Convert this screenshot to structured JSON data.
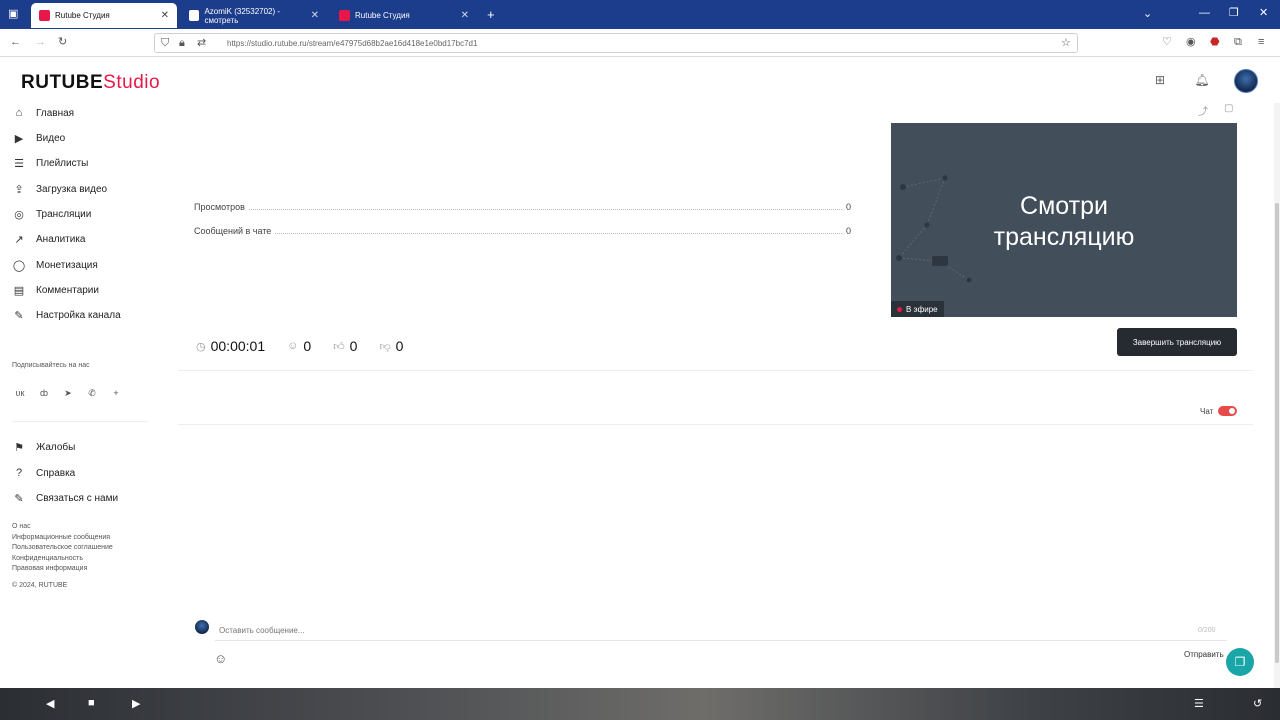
{
  "browser": {
    "tabs": [
      {
        "title": "Rutube Студия",
        "active": true,
        "favicon_color": "#e8174a"
      },
      {
        "title": "AzomiK (32532702) - смотреть",
        "active": false,
        "favicon_color": "#ffffff"
      },
      {
        "title": "Rutube Студия",
        "active": false,
        "favicon_color": "#e8174a"
      }
    ],
    "url": "https://studio.rutube.ru/stream/e47975d68b2ae16d418e1e0bd17bc7d1"
  },
  "app": {
    "logo_main": "RUTUBE",
    "logo_studio": "Studio"
  },
  "sidebar": {
    "items": [
      {
        "label": "Главная",
        "icon": "home-icon"
      },
      {
        "label": "Видео",
        "icon": "video-icon"
      },
      {
        "label": "Плейлисты",
        "icon": "playlist-icon"
      },
      {
        "label": "Загрузка видео",
        "icon": "upload-icon"
      },
      {
        "label": "Трансляции",
        "icon": "broadcast-icon"
      },
      {
        "label": "Аналитика",
        "icon": "analytics-icon"
      },
      {
        "label": "Монетизация",
        "icon": "money-icon"
      },
      {
        "label": "Комментарии",
        "icon": "comments-icon"
      },
      {
        "label": "Настройка канала",
        "icon": "settings-icon"
      }
    ],
    "subscribe_label": "Подписывайтесь на нас",
    "support_items": [
      {
        "label": "Жалобы",
        "icon": "flag-icon"
      },
      {
        "label": "Справка",
        "icon": "help-icon"
      },
      {
        "label": "Связаться с нами",
        "icon": "contact-icon"
      }
    ],
    "footer_links": [
      "О нас",
      "Информационные сообщения",
      "Пользовательское соглашение",
      "Конфиденциальность",
      "Правовая информация"
    ],
    "copyright": "© 2024, RUTUBE"
  },
  "stream": {
    "stats": [
      {
        "label": "Просмотров",
        "value": "0"
      },
      {
        "label": "Сообщений в чате",
        "value": "0"
      }
    ],
    "preview_line1": "Смотри",
    "preview_line2": "трансляцию",
    "live_label": "В эфире",
    "duration": "00:00:01",
    "viewers": "0",
    "likes": "0",
    "dislikes": "0",
    "end_button": "Завершить трансляцию"
  },
  "chat": {
    "label": "Чат",
    "enabled": true,
    "placeholder": "Оставить сообщение...",
    "char_count": "0/200",
    "send_label": "Отправить"
  },
  "colors": {
    "brand": "#e8174a",
    "browser_bar": "#1c3d8c",
    "preview_bg": "#424e5a",
    "support": "#1aa6a6"
  }
}
